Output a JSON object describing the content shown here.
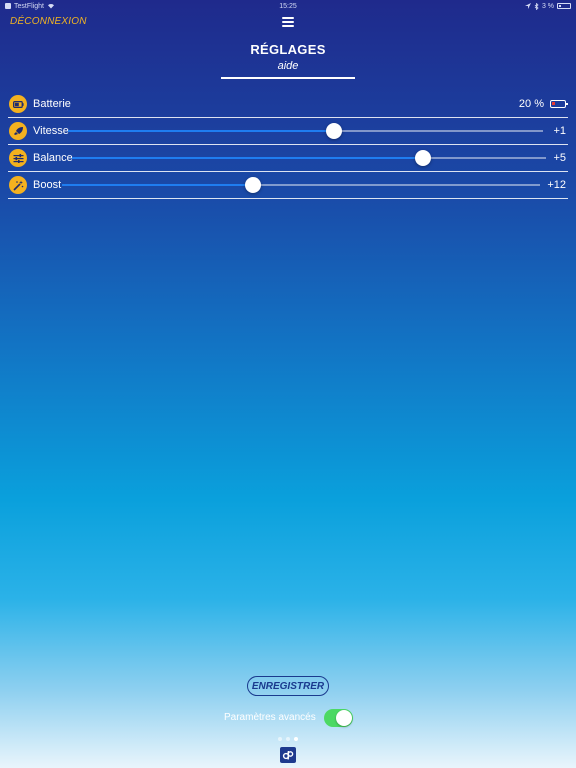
{
  "status_bar": {
    "carrier": "TestFlight",
    "time": "15:25",
    "battery": "3 %"
  },
  "header": {
    "logout_label": "DÉCONNEXION",
    "title": "RÉGLAGES",
    "subtitle": "aide"
  },
  "settings": {
    "battery": {
      "label": "Batterie",
      "value": "20 %",
      "level": 0.2
    },
    "speed": {
      "label": "Vitesse",
      "value": "+1",
      "level": 0.56
    },
    "balance": {
      "label": "Balance",
      "value": "+5",
      "level": 0.74
    },
    "boost": {
      "label": "Boost",
      "value": "+12",
      "level": 0.4
    }
  },
  "footer": {
    "save_label": "ENREGISTRER",
    "advanced_label": "Paramètres avancés",
    "advanced_on": true,
    "page_count": 3,
    "active_page": 3
  },
  "colors": {
    "accent": "#f0b323",
    "toggle_on": "#4cd964",
    "slider_fill": "#1f7df0",
    "button_text": "#1a3a8e"
  }
}
